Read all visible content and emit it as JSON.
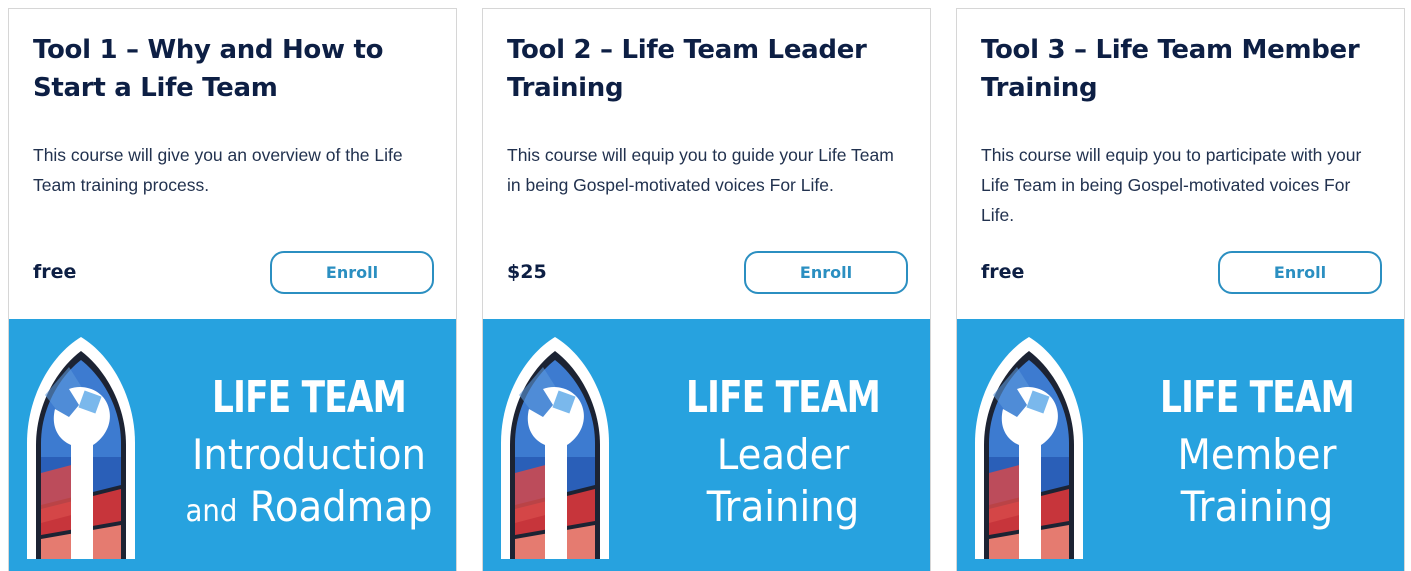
{
  "colors": {
    "title": "#0d1f44",
    "text": "#22324f",
    "accent": "#2b8fc1",
    "banner": "#27a2df"
  },
  "cards": [
    {
      "title": "Tool 1 – Why and How to Start a Life Team",
      "description": "This course will give you an overview of the Life Team training process.",
      "price": "free",
      "button_label": "Enroll",
      "banner": {
        "heading": "LIFE TEAM",
        "line2": "Introduction",
        "line3_small": "and",
        "line3": "Roadmap"
      }
    },
    {
      "title": "Tool 2 – Life Team Leader Training",
      "description": "This course will equip you to guide your Life Team in being Gospel-motivated voices For Life.",
      "price": "$25",
      "button_label": "Enroll",
      "banner": {
        "heading": "LIFE TEAM",
        "line2": "Leader",
        "line3_small": "",
        "line3": "Training"
      }
    },
    {
      "title": "Tool 3 – Life Team Member Training",
      "description": "This course will equip you to participate with your Life Team in being Gospel-motivated voices For Life.",
      "price": "free",
      "button_label": "Enroll",
      "banner": {
        "heading": "LIFE TEAM",
        "line2": "Member",
        "line3_small": "",
        "line3": "Training"
      }
    }
  ]
}
